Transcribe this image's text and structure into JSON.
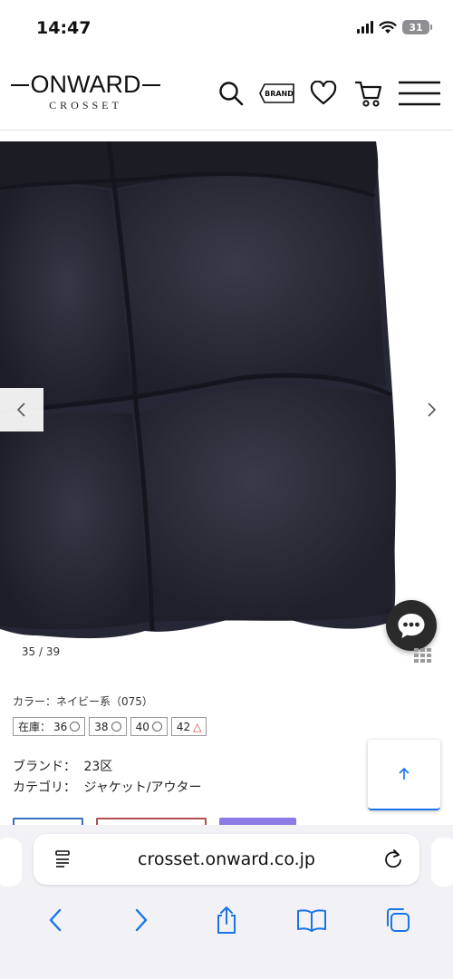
{
  "status_bar": {
    "time": "14:47",
    "battery": "31"
  },
  "header": {
    "logo_main": "ONWARD",
    "logo_sub": "CROSSET",
    "brand_label": "BRAND",
    "icons": [
      "search-icon",
      "brand-tag-icon",
      "heart-icon",
      "cart-icon",
      "menu-icon"
    ]
  },
  "carousel": {
    "counter": "35 / 39",
    "image_color": "#262734"
  },
  "product": {
    "color_text": "カラー：ネイビー系（075）",
    "stock_label": "在庫：",
    "sizes": [
      {
        "size": "36",
        "mark": "circle"
      },
      {
        "size": "38",
        "mark": "circle"
      },
      {
        "size": "40",
        "mark": "circle"
      },
      {
        "size": "42",
        "mark": "triangle"
      }
    ],
    "brand_key": "ブランド：",
    "brand_value": "23区",
    "category_key": "カテゴリ：",
    "category_value": "ジャケット/アウター"
  },
  "browser": {
    "url": "crosset.onward.co.jp",
    "toolbar": [
      "back-icon",
      "forward-icon",
      "share-icon",
      "bookmarks-icon",
      "tabs-icon"
    ]
  },
  "colors": {
    "accent": "#1a73e8",
    "warning": "#d23c3c"
  }
}
